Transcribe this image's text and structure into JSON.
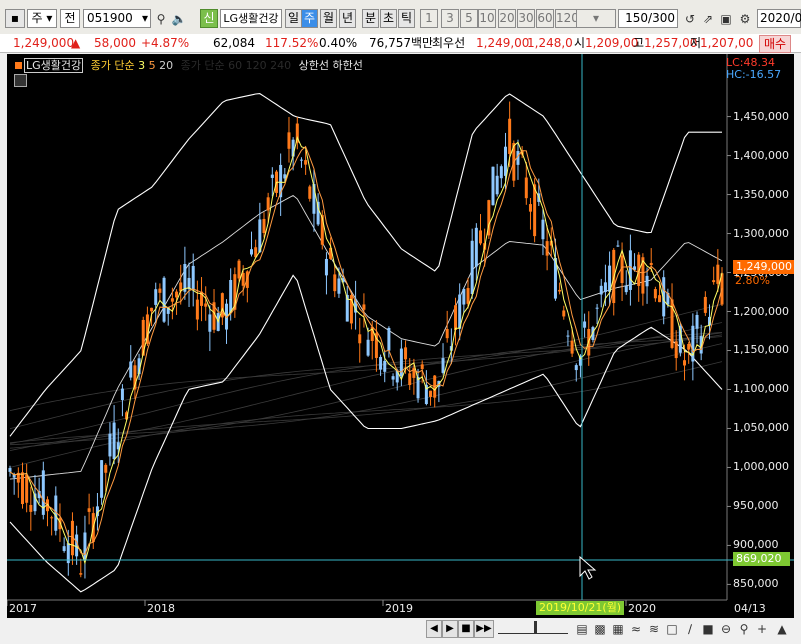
{
  "toolbar": {
    "market": "주",
    "market_tag": "전",
    "code": "051900",
    "credit_badge": "신",
    "stock_name": "LG생활건강",
    "periods": [
      "일",
      "주",
      "월",
      "년",
      "분",
      "초",
      "틱"
    ],
    "active_period": "주",
    "intervals": [
      "1",
      "3",
      "5",
      "10",
      "20",
      "30",
      "60",
      "120"
    ],
    "count": "150",
    "count_total": "/300",
    "date": "2020/0"
  },
  "quote": {
    "price": "1,249,000",
    "arrow": "▲",
    "change": "58,000",
    "change_pct": "+4.87%",
    "volume": "62,084",
    "vol_ratio": "117.52%",
    "turnover": "0.40%",
    "amount": "76,757백만",
    "label_best": "최우선",
    "best_ask": "1,249,00",
    "best_bid": "1,248,0",
    "open_label": "시",
    "open": "1,209,00",
    "high_label": "고",
    "high": "1,257,00",
    "low_label": "저",
    "low": "1,207,00",
    "order_button": "매수"
  },
  "chart": {
    "legend": {
      "stock": "LG생활건강",
      "ma_label": "종가 단순",
      "ma_periods": [
        "3",
        "5",
        "20"
      ],
      "ma_dim": "종가 단순 60 120 240",
      "bands": "상한선 하한선"
    },
    "right_info": {
      "lc": "LC:48.34",
      "hc": "HC:-16.57"
    },
    "price_tag": "1,249,000",
    "pct_tag": "2.80%",
    "cursor_price": "869,020",
    "y_ticks": [
      "1,450,000",
      "1,400,000",
      "1,350,000",
      "1,300,000",
      "1,250,000",
      "1,200,000",
      "1,150,000",
      "1,100,000",
      "1,050,000",
      "1,000,000",
      "950,000",
      "900,000",
      "850,000"
    ],
    "x_labels": [
      "2017",
      "2018",
      "2019",
      "2020"
    ],
    "cursor_date": "2019/10/21(월)",
    "last_date": "04/13",
    "colors": {
      "up": "#ff7a1a",
      "down": "#8ec8ff",
      "ma3": "#ffff66",
      "ma5": "#ff9a40",
      "band": "#ffffff",
      "cross": "#38b8c8",
      "price_tag": "#ff6a00",
      "cursor_tag": "#7ec832"
    }
  },
  "bottom": {
    "scroll_buttons": [
      "◀",
      "▶",
      "■",
      "▶▶"
    ]
  },
  "chart_data": {
    "type": "candlestick",
    "x": [
      "2017-01",
      "2017-03",
      "2017-05",
      "2017-07",
      "2017-09",
      "2017-11",
      "2018-01",
      "2018-03",
      "2018-05",
      "2018-07",
      "2018-09",
      "2018-11",
      "2019-01",
      "2019-03",
      "2019-05",
      "2019-07",
      "2019-09",
      "2019-11",
      "2020-01",
      "2020-03",
      "2020-04"
    ],
    "close": [
      995000,
      960000,
      880000,
      1050000,
      1210000,
      1230000,
      1190000,
      1300000,
      1420000,
      1260000,
      1180000,
      1130000,
      1100000,
      1260000,
      1420000,
      1300000,
      1140000,
      1250000,
      1260000,
      1130000,
      1249000
    ],
    "upper_band": [
      1040000,
      1100000,
      1150000,
      1330000,
      1360000,
      1420000,
      1470000,
      1480000,
      1450000,
      1440000,
      1340000,
      1280000,
      1250000,
      1430000,
      1480000,
      1450000,
      1380000,
      1310000,
      1300000,
      1430000,
      1430000
    ],
    "lower_band": [
      930000,
      880000,
      840000,
      870000,
      1000000,
      1100000,
      1110000,
      1170000,
      1250000,
      1100000,
      1050000,
      1050000,
      1060000,
      1080000,
      1100000,
      1120000,
      1050000,
      1150000,
      1180000,
      1150000,
      1100000
    ],
    "ylim": [
      830000,
      1520000
    ]
  }
}
